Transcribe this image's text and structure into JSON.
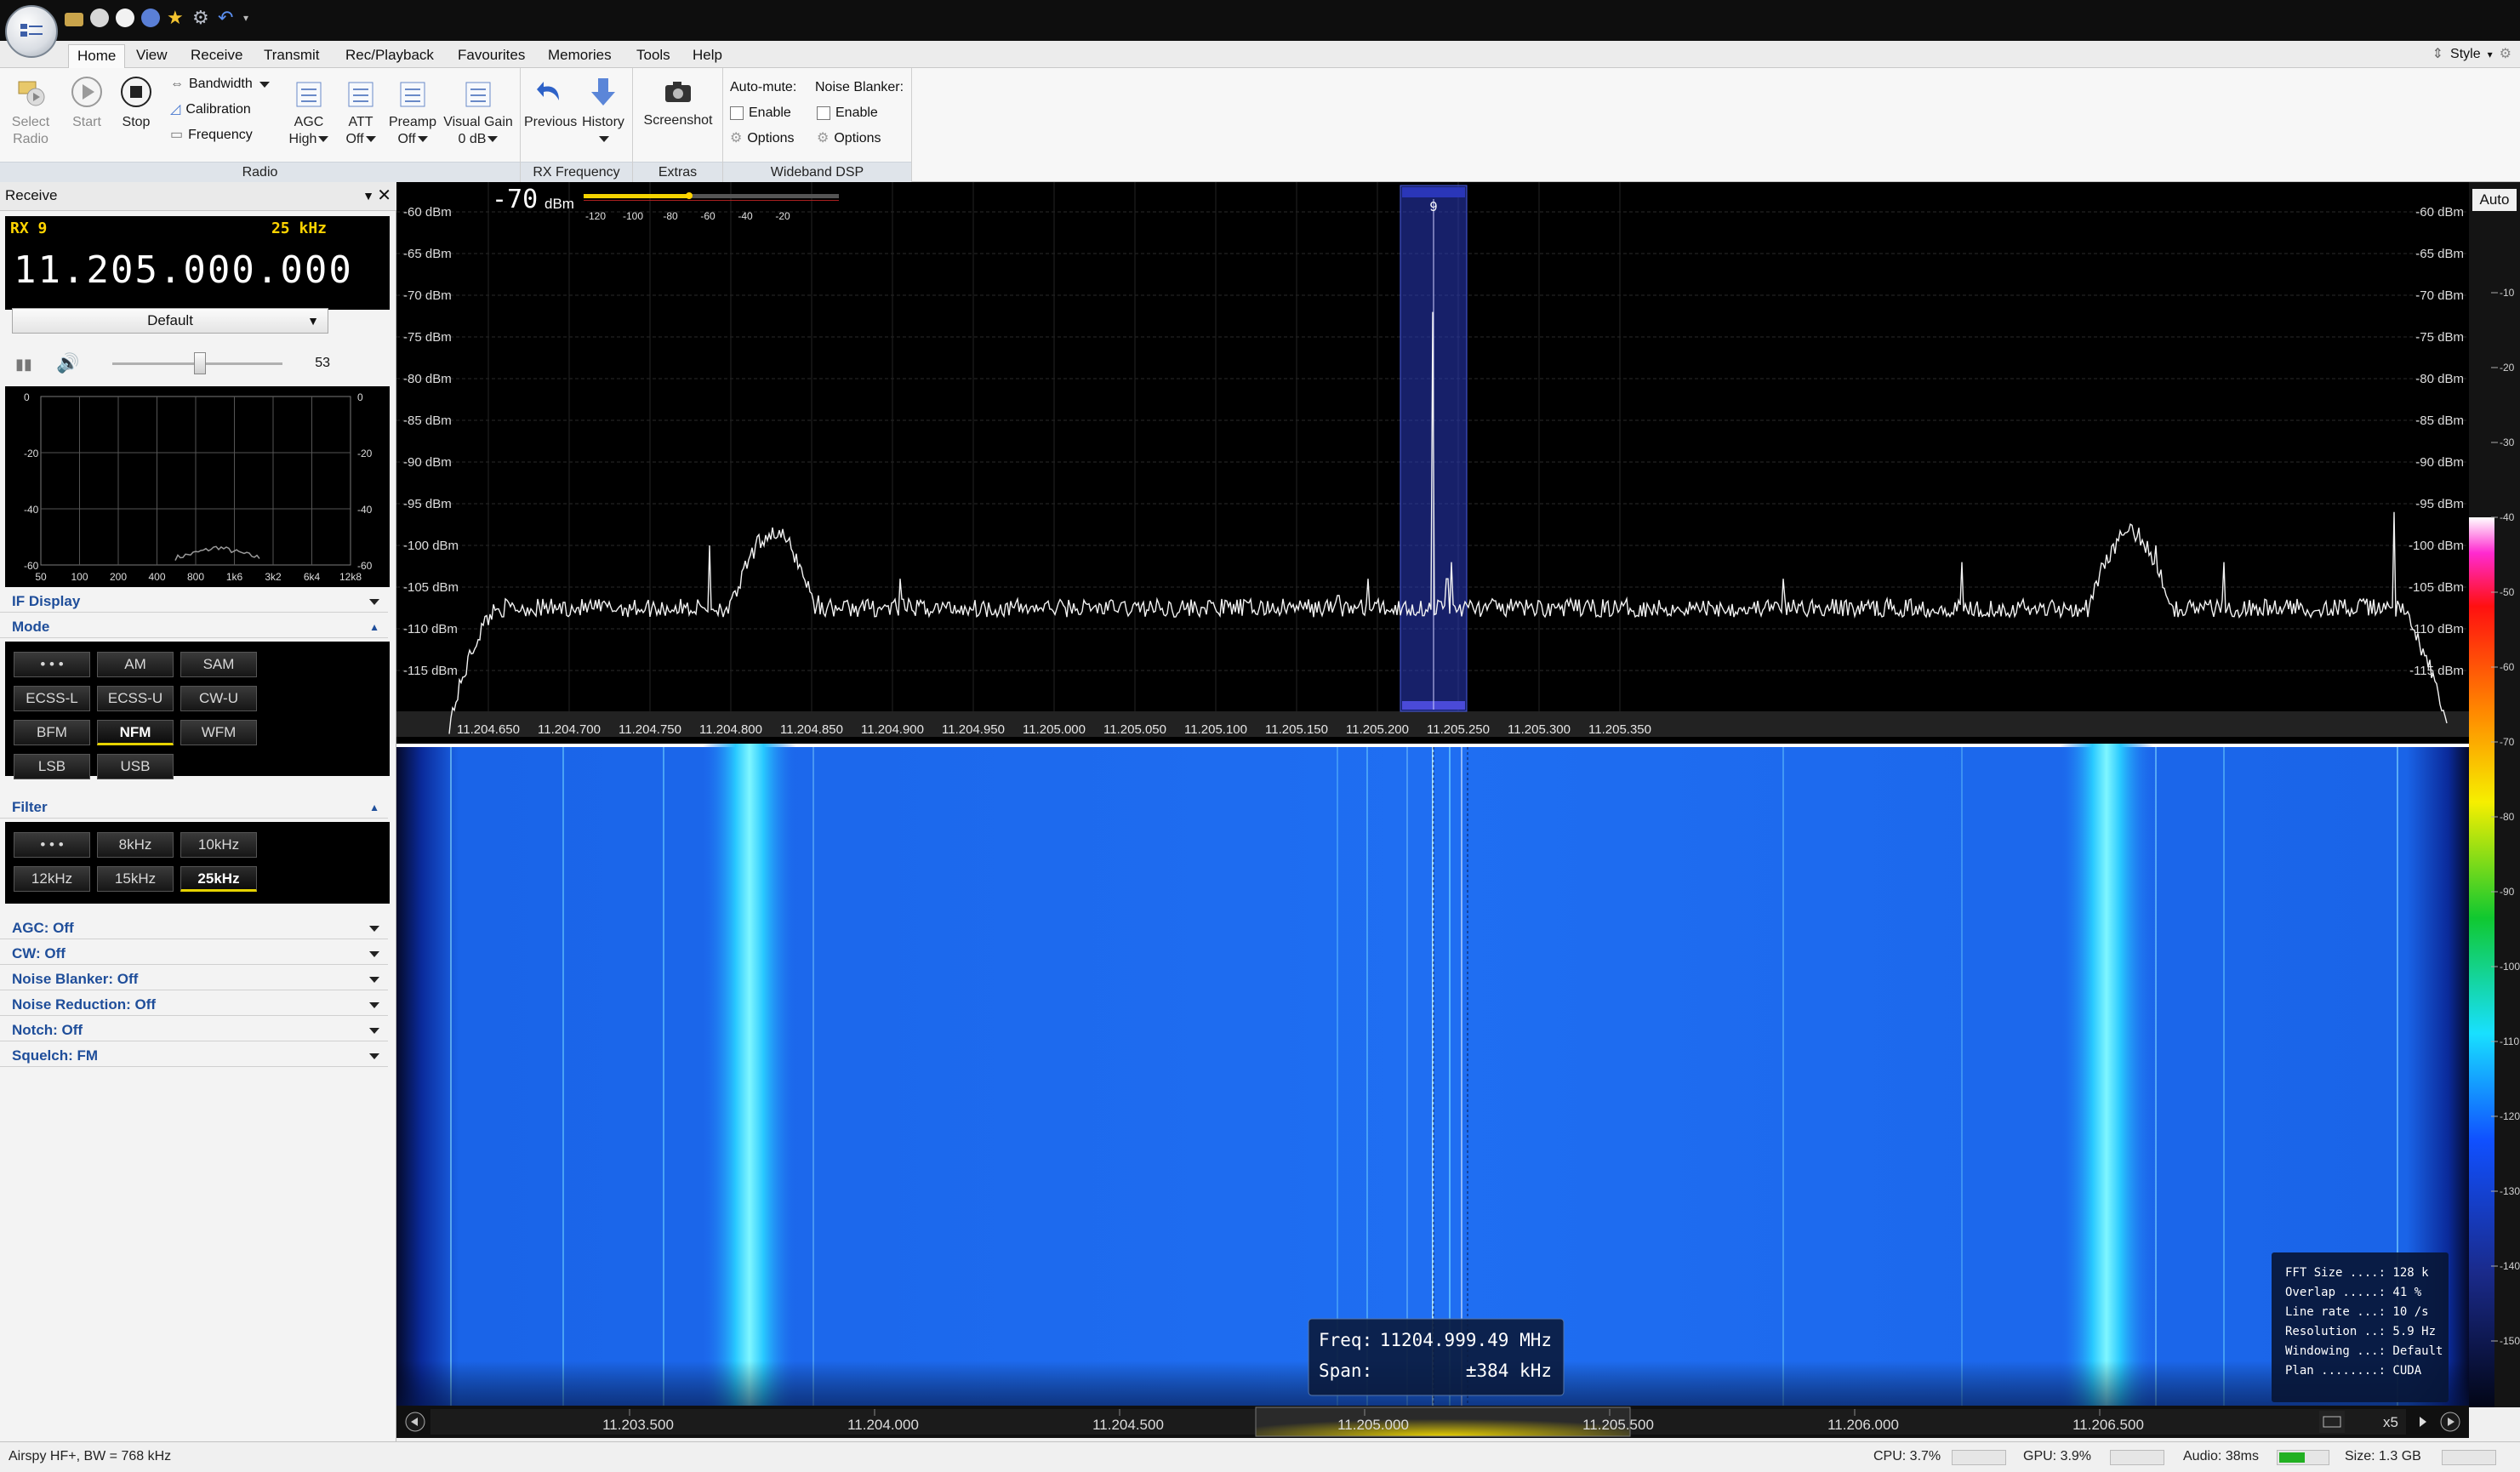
{
  "quick_access": [
    "folder-icon",
    "play-icon",
    "stop-icon",
    "plus-icon",
    "star-icon",
    "settings-icon",
    "undo-icon"
  ],
  "menu": {
    "tabs": [
      "Home",
      "View",
      "Receive",
      "Transmit",
      "Rec/Playback",
      "Favourites",
      "Memories",
      "Tools",
      "Help"
    ],
    "active": "Home",
    "style_label": "Style"
  },
  "ribbon": {
    "select_radio": "Select\nRadio",
    "select_radio_line1": "Select",
    "select_radio_line2": "Radio",
    "start": "Start",
    "stop": "Stop",
    "bandwidth": "Bandwidth",
    "calibration": "Calibration",
    "frequency": "Frequency",
    "agc_label": "AGC",
    "agc_value": "High",
    "att_label": "ATT",
    "att_value": "Off",
    "preamp_label": "Preamp",
    "preamp_value": "Off",
    "visual_gain_label": "Visual Gain",
    "visual_gain_value": "0 dB",
    "radio_group": "Radio",
    "previous": "Previous",
    "history": "History",
    "rx_frequency_group": "RX Frequency",
    "screenshot": "Screenshot",
    "extras_group": "Extras",
    "auto_mute": "Auto-mute:",
    "noise_blanker": "Noise Blanker:",
    "enable": "Enable",
    "options": "Options",
    "wideband_group": "Wideband DSP"
  },
  "receive_panel": {
    "title": "Receive",
    "rx_label": "RX 9",
    "rx_bandwidth": "25 kHz",
    "frequency": "11.205.000.000",
    "preset": "Default",
    "volume_value": "53",
    "volume_level": 0.53,
    "audio_y_ticks": [
      "0",
      "-20",
      "-40",
      "-60"
    ],
    "audio_x_ticks": [
      "50",
      "100",
      "200",
      "400",
      "800",
      "1k6",
      "3k2",
      "6k4",
      "12k8"
    ],
    "if_display": "IF Display",
    "mode_title": "Mode",
    "modes": [
      "• • •",
      "AM",
      "SAM",
      "ECSS-L",
      "ECSS-U",
      "CW-U",
      "BFM",
      "NFM",
      "WFM",
      "LSB",
      "USB"
    ],
    "mode_selected": "NFM",
    "filter_title": "Filter",
    "filters": [
      "• • •",
      "8kHz",
      "10kHz",
      "12kHz",
      "15kHz",
      "25kHz"
    ],
    "filter_selected": "25kHz",
    "collapsed_sections": [
      "AGC: Off",
      "CW: Off",
      "Noise Blanker: Off",
      "Noise Reduction: Off",
      "Notch: Off",
      "Squelch: FM"
    ]
  },
  "spectrum": {
    "signal_readout": "-70",
    "signal_unit": "dBm",
    "meter_ticks": [
      "-120",
      "-100",
      "-80",
      "-60",
      "-40",
      "-20"
    ],
    "meter_level": -70,
    "db_ticks": [
      "-60 dBm",
      "-65 dBm",
      "-70 dBm",
      "-75 dBm",
      "-80 dBm",
      "-85 dBm",
      "-90 dBm",
      "-95 dBm",
      "-100 dBm",
      "-105 dBm",
      "-110 dBm",
      "-115 dBm"
    ],
    "freq_ticks": [
      "11.204.650",
      "11.204.700",
      "11.204.750",
      "11.204.800",
      "11.204.850",
      "11.204.900",
      "11.204.950",
      "11.205.000",
      "11.205.050",
      "11.205.100",
      "11.205.150",
      "11.205.200",
      "11.205.250",
      "11.205.300",
      "11.205.350"
    ],
    "vfo_label": "9"
  },
  "waterfall": {
    "tooltip_freq_label": "Freq:",
    "tooltip_freq_value": "11204.999.49 MHz",
    "tooltip_span_label": "Span:",
    "tooltip_span_value": "±384  kHz",
    "fft_info": [
      "FFT Size ....: 128 k",
      "Overlap .....: 41 %",
      "Line rate ...: 10 /s",
      "Resolution ..: 5.9 Hz",
      "Windowing ...: Default",
      "Plan ........: CUDA"
    ],
    "overview_ticks": [
      "11.203.500",
      "11.204.000",
      "11.204.500",
      "11.205.000",
      "11.205.500",
      "11.206.000",
      "11.206.500"
    ],
    "zoom_label": "x5"
  },
  "colorscale": {
    "auto_label": "Auto",
    "ticks": [
      "-10",
      "-20",
      "-30",
      "-40",
      "-50",
      "-60",
      "-70",
      "-80",
      "-90",
      "-100",
      "-110",
      "-120",
      "-130",
      "-140",
      "-150"
    ]
  },
  "status": {
    "device": "Airspy HF+, BW = 768 kHz",
    "cpu": "CPU: 3.7%",
    "gpu": "GPU: 3.9%",
    "audio": "Audio: 38ms",
    "size": "Size: 1.3 GB"
  },
  "colors": {
    "accent_blue": "#1f4e9a",
    "waterfall_blue": "#1d6cf0",
    "signal_cyan": "#5ff0ff",
    "selected_yellow": "#e6d300",
    "vfo_blue": "#2a3ac0"
  }
}
